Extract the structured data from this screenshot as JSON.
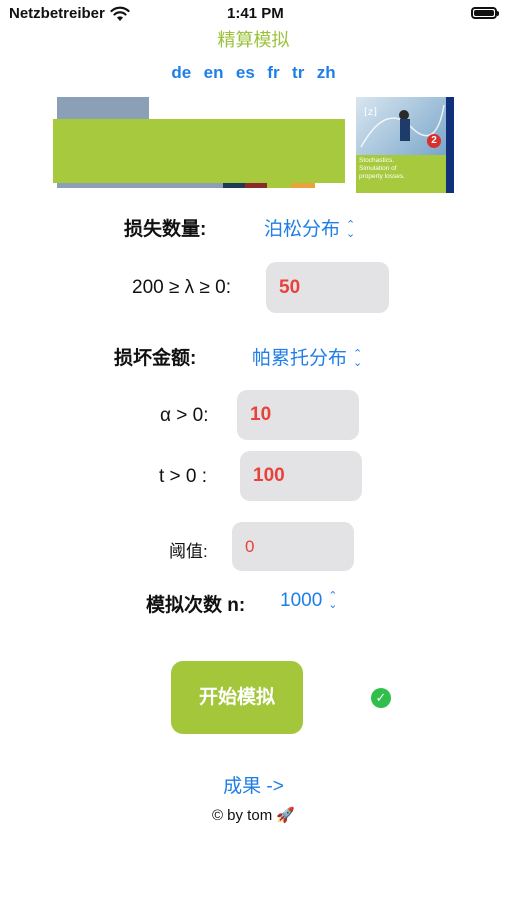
{
  "status_bar": {
    "carrier": "Netzbetreiber",
    "time": "1:41 PM"
  },
  "nav": {
    "title": "精算模拟"
  },
  "languages": [
    "de",
    "en",
    "es",
    "fr",
    "tr",
    "zh"
  ],
  "book": {
    "badge": "2",
    "cover_lines": [
      "Stochastics.",
      "Simulation of",
      "property losses."
    ]
  },
  "colors": {
    "accent_green": "#a7c93d",
    "link_blue": "#1f7fe6",
    "value_red": "#e8423a",
    "success_green": "#2fbf4a",
    "stripes": [
      "#1d3a56",
      "#8b2a2a",
      "#a7c93d",
      "#e8a33a"
    ]
  },
  "form": {
    "loss_count": {
      "label": "损失数量:",
      "distribution": "泊松分布"
    },
    "lambda": {
      "label": "200 ≥ λ ≥ 0:",
      "value": "50"
    },
    "damage_amount": {
      "label": "损坏金额:",
      "distribution": "帕累托分布"
    },
    "alpha": {
      "label": "α > 0:",
      "value": "10"
    },
    "t": {
      "label": "t > 0 :",
      "value": "100"
    },
    "threshold": {
      "label": "阈值:",
      "value": "0"
    },
    "simulations": {
      "label": "模拟次数 n:",
      "value": "1000"
    }
  },
  "actions": {
    "start_label": "开始模拟",
    "results_label": "成果 ->"
  },
  "footer": {
    "credit": "© by tom 🚀"
  },
  "icons": {
    "wifi": "wifi-icon",
    "battery": "battery-icon",
    "chevron": "chevron-up-down-icon",
    "check": "checkmark-icon"
  }
}
